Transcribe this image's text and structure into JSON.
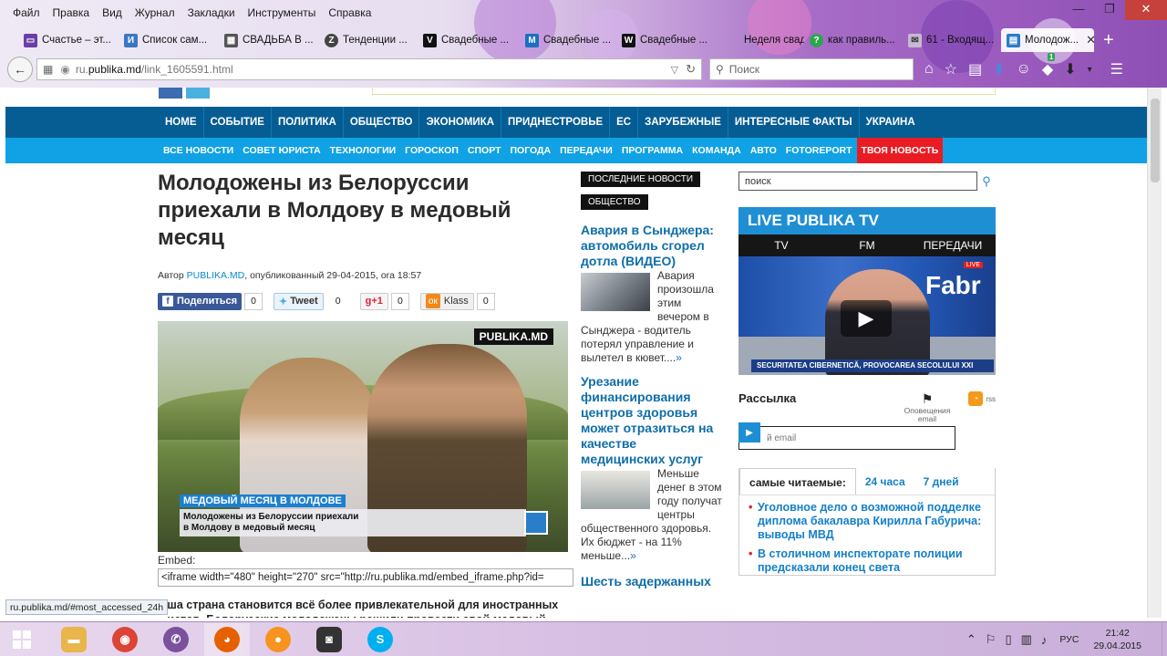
{
  "browser": {
    "menu": [
      "Файл",
      "Правка",
      "Вид",
      "Журнал",
      "Закладки",
      "Инструменты",
      "Справка"
    ],
    "tabs": [
      {
        "label": "Счастье – эт...",
        "icon_color": "#6b3fa6",
        "icon": "tv-icon"
      },
      {
        "label": "Список сам...",
        "icon_color": "#3a78c2",
        "icon_glyph": "И"
      },
      {
        "label": "СВАДЬБА В ...",
        "icon_color": "#555555",
        "icon": "photo-icon"
      },
      {
        "label": "Тенденции ...",
        "icon_color": "#444444",
        "icon_glyph": "Z"
      },
      {
        "label": "Свадебные ...",
        "icon_color": "#111111",
        "icon_glyph": "V"
      },
      {
        "label": "Свадебные ...",
        "icon_color": "#1a6fc0",
        "icon_glyph": "M"
      },
      {
        "label": "Свадебные ...",
        "icon_color": "#111111",
        "icon_glyph": "W"
      },
      {
        "label": "Неделя свад...",
        "icon_color": "#9a6fb0",
        "icon": "blank-icon"
      },
      {
        "label": "как правиль...",
        "icon_color": "#2ea44f",
        "icon_glyph": "?"
      },
      {
        "label": "61 - Входящ...",
        "icon_color": "#c7b9d2",
        "icon": "mail-icon"
      },
      {
        "label": "Молодож...",
        "icon_color": "#2a7dc9",
        "icon": "page-icon",
        "active": true
      }
    ],
    "url_prefix": "ru.",
    "url_domain": "publika.md",
    "url_path": "/link_1605591.html",
    "search_placeholder": "Поиск",
    "status_url": "ru.publika.md/#most_accessed_24h",
    "badge_count": "1"
  },
  "site": {
    "nav_primary": [
      "HOME",
      "СОБЫТИЕ",
      "ПОЛИТИКА",
      "ОБЩЕСТВО",
      "ЭКОНОМИКА",
      "ПРИДНЕСТРОВЬЕ",
      "ЕС",
      "ЗАРУБЕЖНЫЕ",
      "ИНТЕРЕСНЫЕ ФАКТЫ",
      "УКРАИНА"
    ],
    "nav_secondary": [
      "ВСЕ НОВОСТИ",
      "СОВЕТ ЮРИСТА",
      "ТЕХНОЛОГИИ",
      "ГОРОСКОП",
      "СПОРТ",
      "ПОГОДА",
      "ПЕРЕДАЧИ",
      "ПРОГРАММА",
      "КОМАНДА",
      "АВТО",
      "FOTOREPORT"
    ],
    "nav_highlight": "ТВОЯ НОВОСТЬ",
    "colors": {
      "nav_primary": "#065d93",
      "nav_secondary": "#10a2e4",
      "highlight": "#e91c24",
      "link": "#0f6ea8"
    }
  },
  "article": {
    "title": "Молодожены из Белоруссии приехали в Молдову в медовый месяц",
    "meta_prefix": "Автор ",
    "author": "PUBLIKA.MD",
    "meta_suffix": ", опубликованный 29-04-2015, ora 18:57",
    "share": {
      "fb_label": "Поделиться",
      "fb_count": "0",
      "tw_label": "Tweet",
      "tw_count": "0",
      "gp_label": "g+1",
      "gp_count": "0",
      "ok_label": "Klass",
      "ok_count": "0"
    },
    "video": {
      "logo": "PUBLIKA.MD",
      "tag": "МЕДОВЫЙ МЕСЯЦ В МОЛДОВЕ",
      "caption_line1": "Молодожены из Белоруссии приехали",
      "caption_line2": "в Молдову в медовый месяц"
    },
    "embed_label": "Embed:",
    "embed_code": "<iframe width=\"480\" height=\"270\" src=\"http://ru.publika.md/embed_iframe.php?id=",
    "body_preview": "...ша страна становится всё более привлекательной для иностранных ...истов. Белорусские молодожены решили провести свой медовый"
  },
  "newscol": {
    "label_latest": "ПОСЛЕДНИЕ НОВОСТИ",
    "label_category": "ОБЩЕСТВО",
    "items": [
      {
        "title": "Авария в Сынджера: автомобиль сгорел дотла (ВИДЕО)",
        "text": "Авария произошла этим вечером в Сынджера - водитель потерял управление и вылетел в кювет....",
        "more": "»"
      },
      {
        "title": "Урезание финансирования центров здоровья может отразиться на качестве медицинских услуг",
        "text": "Меньше денег в этом году получат центры общественного здоровья. Их бюджет - на 11% меньше...",
        "more": "»"
      },
      {
        "title": "Шесть задержанных"
      }
    ]
  },
  "rightcol": {
    "search_value": "поиск",
    "live_title": "LIVE PUBLIKA TV",
    "live_tabs": [
      "TV",
      "FM",
      "ПЕРЕДАЧИ"
    ],
    "player_brand": "Fabr",
    "player_live": "LIVE",
    "player_ticker": "SECURITATEA CIBERNETICĂ, PROVOCAREA SECOLULUI XXI",
    "newsletter_title": "Рассылка",
    "newsletter_icon_label": "Оповещения email",
    "rss_label": "rss",
    "email_placeholder": "й email",
    "mostread_tabs": [
      "самые читаемые:",
      "24 часа",
      "7 дней"
    ],
    "mostread_items": [
      "Уголовное дело о возможной подделке диплома бакалавра Кирилла Габурича: выводы МВД",
      "В столичном инспекторате полиции предсказали конец света"
    ]
  },
  "taskbar": {
    "lang": "РУС",
    "time": "21:42",
    "date": "29.04.2015",
    "apps": [
      {
        "name": "explorer",
        "color": "#e8b64a",
        "icon": "folder-icon"
      },
      {
        "name": "chrome",
        "color": "#db4437",
        "icon": "chrome-icon"
      },
      {
        "name": "viber",
        "color": "#7b519d",
        "icon": "viber-icon"
      },
      {
        "name": "firefox",
        "color": "#e66000",
        "icon": "firefox-icon"
      },
      {
        "name": "ok",
        "color": "#f7931e",
        "icon": "ok-icon"
      },
      {
        "name": "camera",
        "color": "#333333",
        "icon": "camera-icon"
      },
      {
        "name": "skype",
        "color": "#00aff0",
        "icon": "skype-icon"
      }
    ]
  }
}
